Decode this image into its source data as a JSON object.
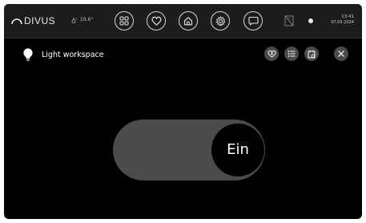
{
  "topbar": {
    "brand": "DIVUS",
    "temperature": "19.6°",
    "nav": {
      "apps_icon": "apps-grid-icon",
      "favorites_icon": "heart-icon",
      "home_icon": "home-icon",
      "settings_icon": "gear-icon",
      "messages_icon": "chat-icon"
    },
    "network_icon": "network-disconnected-icon",
    "status_icon": "status-dot-icon",
    "time": "13:41",
    "date": "07.05.2024"
  },
  "header": {
    "icon": "lightbulb-icon",
    "title": "Light workspace",
    "actions": [
      "add-favorite-icon",
      "list-icon",
      "schedule-icon",
      "close-icon"
    ]
  },
  "switch": {
    "state_label": "Ein",
    "on": true
  },
  "colors": {
    "background": "#000000",
    "topbar": "#1c1c1c",
    "toggle_track": "#4b4b4b",
    "action_button": "#4a4a4a",
    "text": "#ffffff"
  }
}
